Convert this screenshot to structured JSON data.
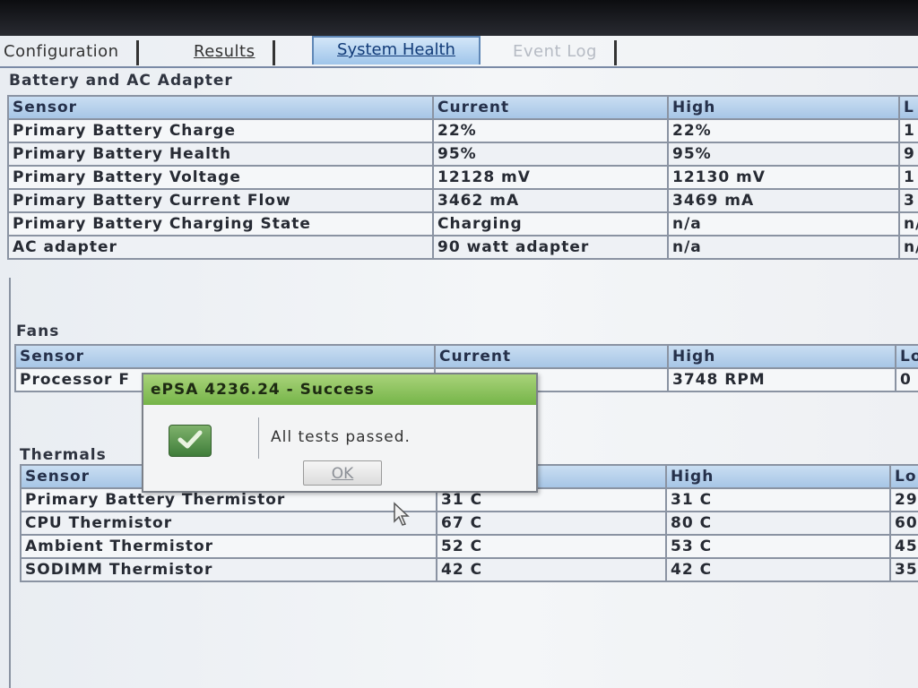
{
  "tabs": [
    {
      "label": "Configuration"
    },
    {
      "label": "Results"
    },
    {
      "label": "System Health"
    },
    {
      "label": "Event Log"
    }
  ],
  "battery": {
    "title": "Battery and AC Adapter",
    "headers": [
      "Sensor",
      "Current",
      "High",
      "L"
    ],
    "rows": [
      [
        "Primary Battery Charge",
        "22%",
        "22%",
        "1"
      ],
      [
        "Primary Battery Health",
        "95%",
        "95%",
        "9"
      ],
      [
        "Primary Battery Voltage",
        "12128 mV",
        "12130 mV",
        "1"
      ],
      [
        "Primary Battery Current Flow",
        "3462 mA",
        "3469 mA",
        "3"
      ],
      [
        "Primary Battery Charging State",
        "Charging",
        "n/a",
        "n/"
      ],
      [
        "AC adapter",
        "90 watt adapter",
        "n/a",
        "n/"
      ]
    ]
  },
  "fans": {
    "title": "Fans",
    "headers": [
      "Sensor",
      "Current",
      "High",
      "Lo"
    ],
    "rows": [
      [
        "Processor F",
        "",
        "3748 RPM",
        "0"
      ]
    ]
  },
  "thermals": {
    "title": "Thermals",
    "headers": [
      "Sensor",
      "",
      "High",
      "Lo"
    ],
    "rows": [
      [
        "Primary Battery Thermistor",
        "31 C",
        "31 C",
        "29"
      ],
      [
        "CPU Thermistor",
        "67 C",
        "80 C",
        "60"
      ],
      [
        "Ambient Thermistor",
        "52 C",
        "53 C",
        "45"
      ],
      [
        "SODIMM Thermistor",
        "42 C",
        "42 C",
        "35"
      ]
    ]
  },
  "dialog": {
    "title": "ePSA 4236.24 - Success",
    "message": "All tests passed.",
    "ok_label": "OK"
  },
  "colors": {
    "accent": "#9fc5ea",
    "dialog_title": "#75b448",
    "success_icon": "#4f8d45"
  },
  "icons": {
    "success": "checkmark-icon",
    "cursor": "mouse-pointer-icon"
  }
}
